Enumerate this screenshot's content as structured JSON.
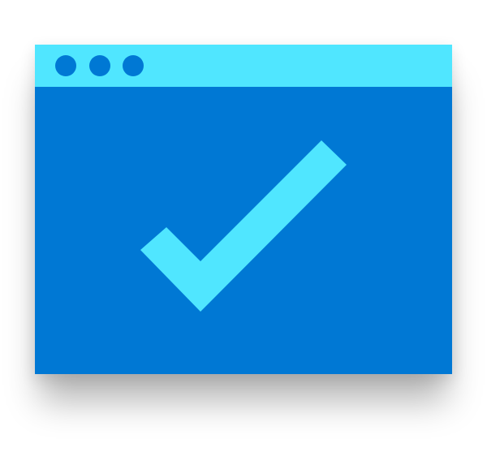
{
  "window": {
    "icon": "browser-window-checkmark-icon",
    "body_color": "#0078d4",
    "titlebar_color": "#50e6ff",
    "titlebar_dots": [
      "dot",
      "dot",
      "dot"
    ],
    "content_icon": "checkmark-icon",
    "checkmark_color": "#50e6ff"
  }
}
